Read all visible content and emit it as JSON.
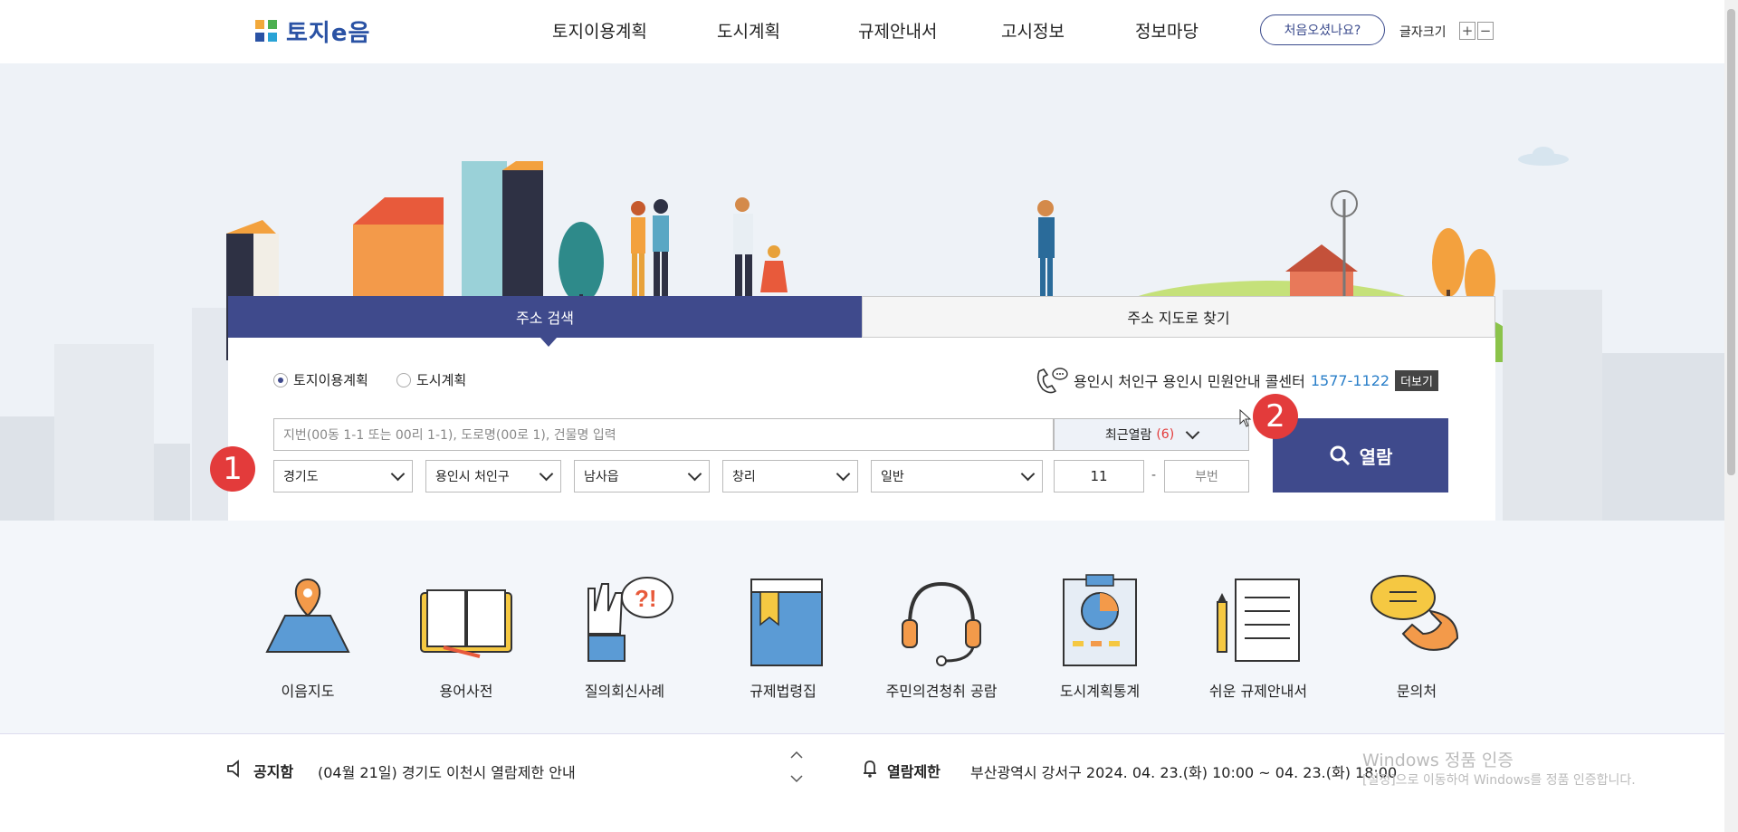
{
  "header": {
    "logo_text": "토지e음",
    "nav": [
      "토지이용계획",
      "도시계획",
      "규제안내서",
      "고시정보",
      "정보마당"
    ],
    "first_visit_label": "처음오셨나요?",
    "font_size_label": "글자크기",
    "font_plus": "+",
    "font_minus": "−"
  },
  "search": {
    "tabs": [
      "주소 검색",
      "주소 지도로 찾기"
    ],
    "radio_options": [
      "토지이용계획",
      "도시계획"
    ],
    "selected_radio": "토지이용계획",
    "callcenter_text": "용인시 처인구 용인시 민원안내 콜센터",
    "callcenter_number": "1577-1122",
    "more_label": "더보기",
    "input_placeholder": "지번(00동 1-1 또는 00리 1-1), 도로명(00로 1), 건물명 입력",
    "recent_label": "최근열람",
    "recent_count": "(6)",
    "selects": [
      "경기도",
      "용인시 처인구",
      "남사읍",
      "창리",
      "일반"
    ],
    "main_number": "11",
    "dash": "-",
    "sub_number_placeholder": "부번",
    "view_label": "열람",
    "badge_1": "1",
    "badge_2": "2"
  },
  "quick_menu": [
    "이음지도",
    "용어사전",
    "질의회신사례",
    "규제법령집",
    "주민의견청취 공람",
    "도시계획통계",
    "쉬운 규제안내서",
    "문의처"
  ],
  "notice": {
    "label": "공지함",
    "text": "(04월 21일) 경기도 이천시 열람제한 안내",
    "restrict_label": "열람제한",
    "restrict_text": "부산광역시 강서구 2024. 04. 23.(화) 10:00 ~ 04. 23.(화) 18:00"
  },
  "watermark": {
    "line1": "Windows 정품 인증",
    "line2": "[설정]으로 이동하여 Windows를 정품 인증합니다."
  },
  "colors": {
    "primary": "#3f4a8c",
    "accent_red": "#e33b3b",
    "link_blue": "#2a7fc9"
  }
}
